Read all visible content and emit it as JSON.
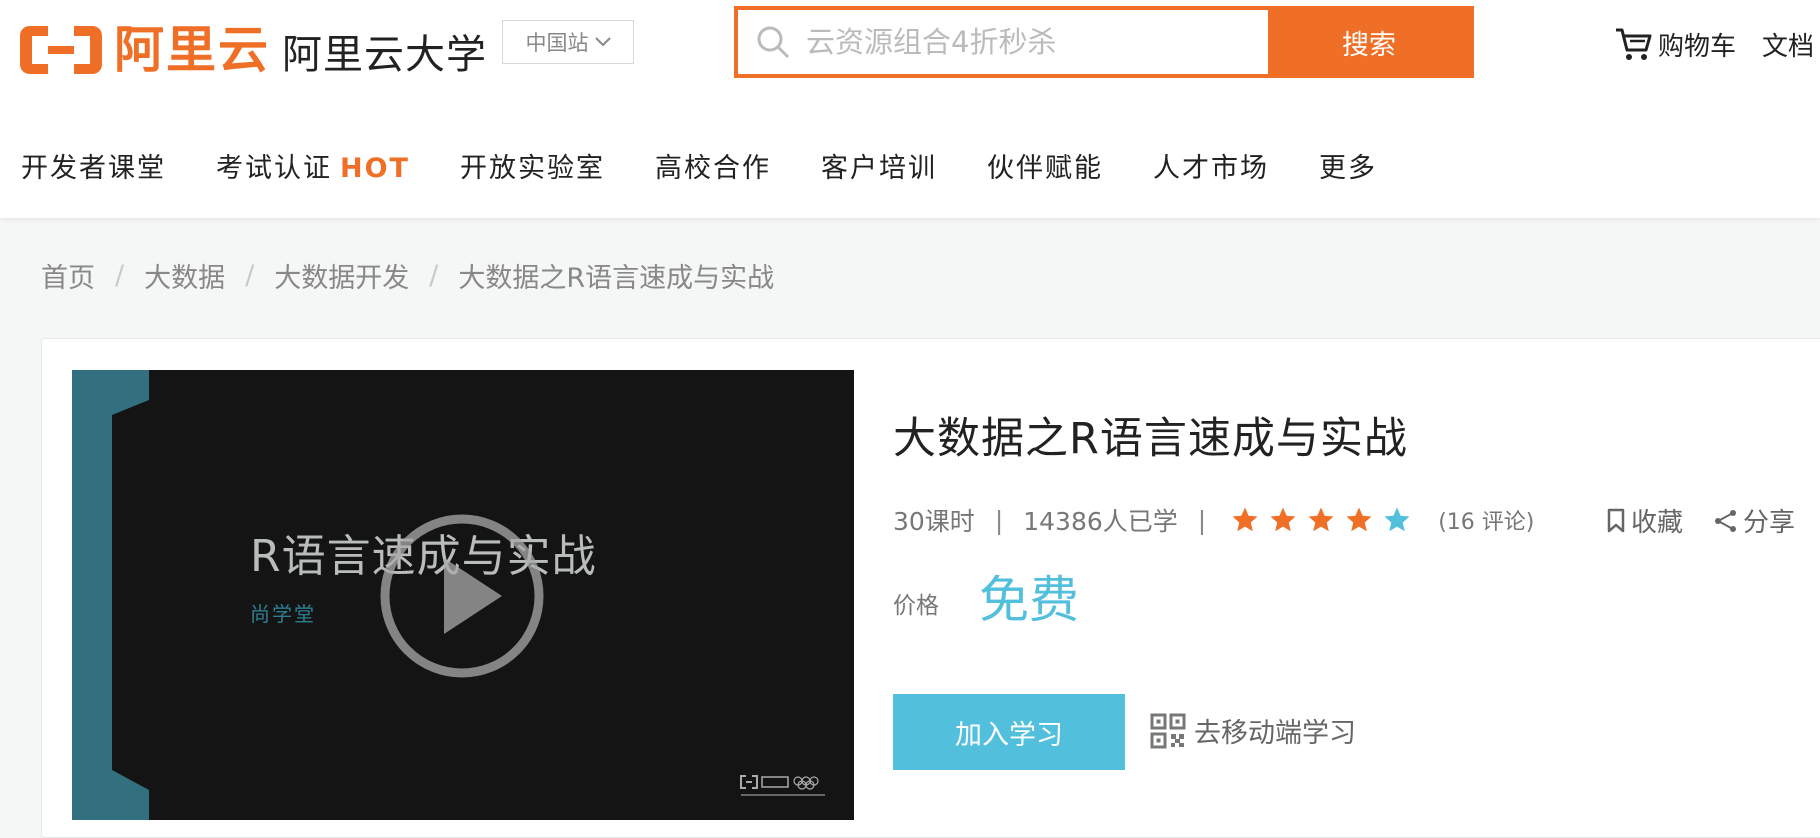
{
  "brand": {
    "logo_text": "阿里云",
    "site_name": "阿里云大学",
    "accent_color": "#ef6f26",
    "logo_icon": "aliyun-logo-icon"
  },
  "header": {
    "region_label": "中国站",
    "search_placeholder": "云资源组合4折秒杀",
    "search_button": "搜索",
    "cart_label": "购物车",
    "docs_label": "文档"
  },
  "nav": {
    "items": [
      {
        "label": "开发者课堂"
      },
      {
        "label": "考试认证",
        "badge": "HOT"
      },
      {
        "label": "开放实验室"
      },
      {
        "label": "高校合作"
      },
      {
        "label": "客户培训"
      },
      {
        "label": "伙伴赋能"
      },
      {
        "label": "人才市场"
      },
      {
        "label": "更多"
      }
    ]
  },
  "breadcrumb": {
    "separator": "/",
    "items": [
      "首页",
      "大数据",
      "大数据开发",
      "大数据之R语言速成与实战"
    ]
  },
  "video": {
    "title": "R语言速成与实战",
    "subtitle": "尚学堂",
    "play_icon": "play-icon"
  },
  "course": {
    "title": "大数据之R语言速成与实战",
    "lessons": "30课时",
    "learners": "14386人已学",
    "rating_stars": 5,
    "rating_color_filled": "#ef6f26",
    "rating_color_last": "#52bfdd",
    "reviews": "(16 评论)",
    "favorite_label": "收藏",
    "share_label": "分享",
    "price_label": "价格",
    "price_value": "免费",
    "price_color": "#52bfdd",
    "join_button": "加入学习",
    "mobile_label": "去移动端学习"
  }
}
